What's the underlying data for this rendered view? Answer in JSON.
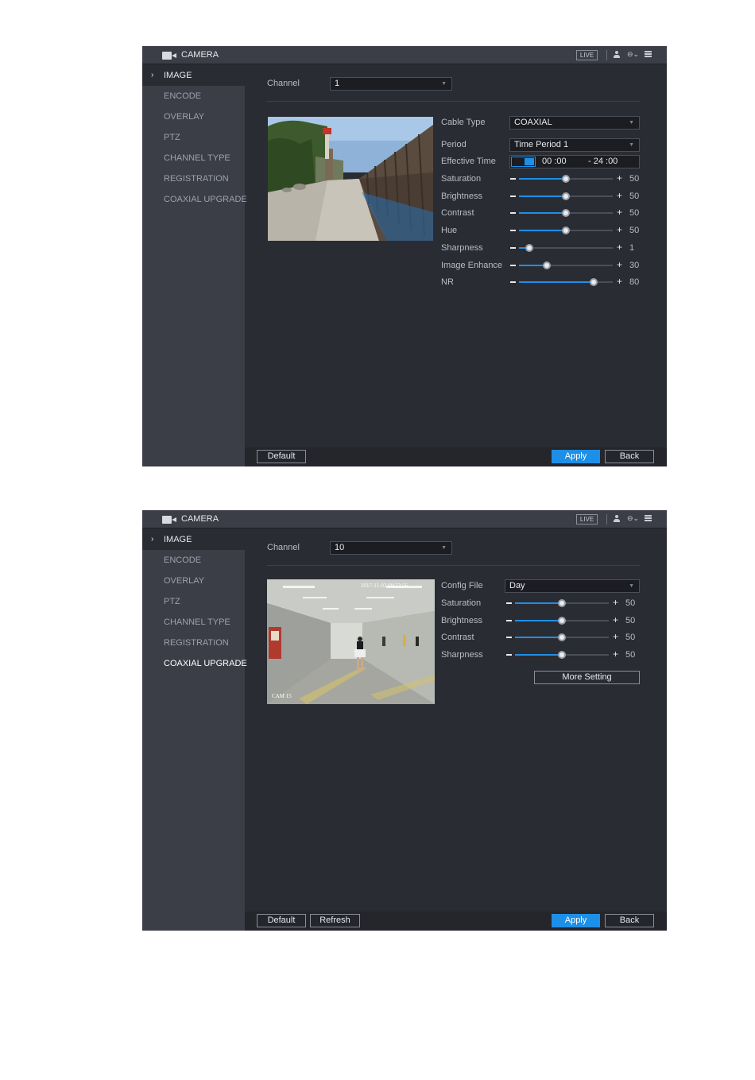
{
  "colors": {
    "accent": "#1e8fe6",
    "panel_bg": "#2a2c33",
    "sidebar_bg": "#3b3e47"
  },
  "screens": [
    {
      "app_title": "CAMERA",
      "live_label": "LIVE",
      "sidebar": [
        "IMAGE",
        "ENCODE",
        "OVERLAY",
        "PTZ",
        "CHANNEL TYPE",
        "REGISTRATION",
        "COAXIAL UPGRADE"
      ],
      "channel": {
        "label": "Channel",
        "value": "1"
      },
      "cable_type": {
        "label": "Cable Type",
        "value": "COAXIAL"
      },
      "period": {
        "label": "Period",
        "value": "Time Period 1"
      },
      "effective_time": {
        "label": "Effective Time",
        "start": "00 :00",
        "end": "- 24 :00"
      },
      "sliders": [
        {
          "label": "Saturation",
          "value": 50,
          "fraction": 0.5
        },
        {
          "label": "Brightness",
          "value": 50,
          "fraction": 0.5
        },
        {
          "label": "Contrast",
          "value": 50,
          "fraction": 0.5
        },
        {
          "label": "Hue",
          "value": 50,
          "fraction": 0.5
        },
        {
          "label": "Sharpness",
          "value": 1,
          "fraction": 0.11
        },
        {
          "label": "Image Enhance",
          "value": 30,
          "fraction": 0.3
        },
        {
          "label": "NR",
          "value": 80,
          "fraction": 0.8
        }
      ],
      "buttons": {
        "default": "Default",
        "apply": "Apply",
        "back": "Back"
      }
    },
    {
      "app_title": "CAMERA",
      "live_label": "LIVE",
      "sidebar": [
        "IMAGE",
        "ENCODE",
        "OVERLAY",
        "PTZ",
        "CHANNEL TYPE",
        "REGISTRATION",
        "COAXIAL UPGRADE"
      ],
      "channel": {
        "label": "Channel",
        "value": "10"
      },
      "config_file": {
        "label": "Config File",
        "value": "Day"
      },
      "preview_timestamp": "2017-11-03 09:33:56",
      "preview_cam_label": "CAM 15",
      "sliders": [
        {
          "label": "Saturation",
          "value": 50,
          "fraction": 0.5
        },
        {
          "label": "Brightness",
          "value": 50,
          "fraction": 0.5
        },
        {
          "label": "Contrast",
          "value": 50,
          "fraction": 0.5
        },
        {
          "label": "Sharpness",
          "value": 50,
          "fraction": 0.5
        }
      ],
      "more_setting": "More Setting",
      "buttons": {
        "default": "Default",
        "refresh": "Refresh",
        "apply": "Apply",
        "back": "Back"
      }
    }
  ]
}
